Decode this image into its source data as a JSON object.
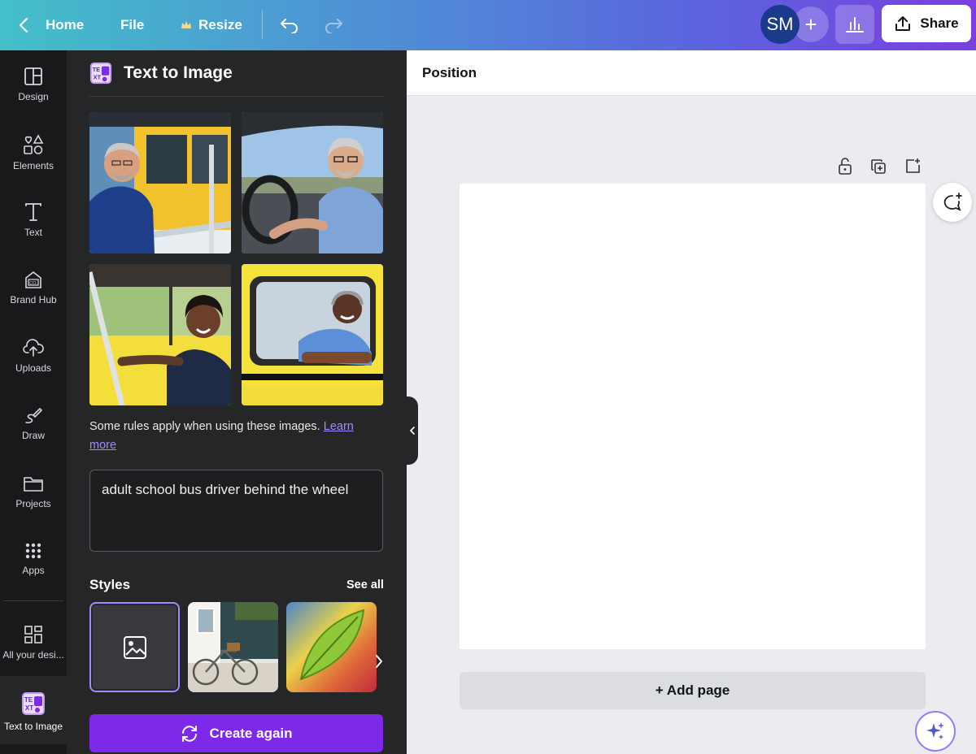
{
  "topbar": {
    "home": "Home",
    "file": "File",
    "resize": "Resize",
    "avatar_initials": "SM",
    "share": "Share"
  },
  "rail": {
    "items": [
      {
        "label": "Design",
        "icon": "design-layout-icon"
      },
      {
        "label": "Elements",
        "icon": "elements-shapes-icon"
      },
      {
        "label": "Text",
        "icon": "text-t-icon"
      },
      {
        "label": "Brand Hub",
        "icon": "brand-hub-icon"
      },
      {
        "label": "Uploads",
        "icon": "cloud-upload-icon"
      },
      {
        "label": "Draw",
        "icon": "draw-pen-icon"
      },
      {
        "label": "Projects",
        "icon": "folder-icon"
      },
      {
        "label": "Apps",
        "icon": "apps-grid-icon"
      },
      {
        "label": "All your desi...",
        "icon": "all-designs-grid-icon"
      },
      {
        "label": "Text to Image",
        "icon": "text-to-image-app-icon"
      }
    ]
  },
  "panel": {
    "title": "Text to Image",
    "rules_text": "Some rules apply when using these images.",
    "learn_more": "Learn more",
    "prompt": "adult school bus driver behind the wheel",
    "styles_label": "Styles",
    "see_all": "See all",
    "create_again": "Create again",
    "results": [
      {
        "desc": "smiling older man in blue polo at yellow school bus window"
      },
      {
        "desc": "smiling man with glasses behind steering wheel"
      },
      {
        "desc": "smiling woman driver in yellow bus"
      },
      {
        "desc": "smiling man leaning from yellow bus window"
      }
    ]
  },
  "canvas": {
    "position": "Position",
    "add_page": "+ Add page"
  },
  "colors": {
    "accent": "#7d2ae8",
    "panel_bg": "#252627",
    "rail_bg": "#18191b",
    "link": "#a38bff"
  }
}
